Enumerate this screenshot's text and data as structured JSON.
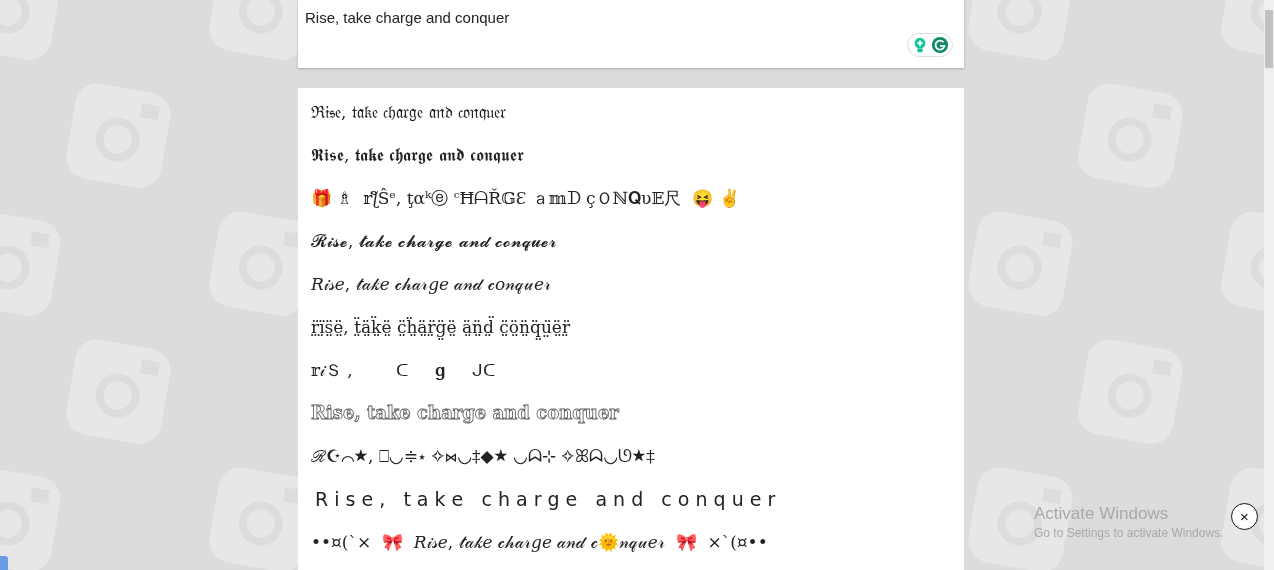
{
  "input": {
    "value": "Rise, take charge and conquer"
  },
  "results": [
    {
      "kind": "plain",
      "text": "ℜ𝔦𝔰𝔢, 𝔱𝔞𝔨𝔢 𝔠𝔥𝔞𝔯𝔤𝔢 𝔞𝔫𝔡 𝔠𝔬𝔫𝔮𝔲𝔢𝔯"
    },
    {
      "kind": "plain",
      "text": "𝕽𝖎𝖘𝖊, 𝖙𝖆𝖐𝖊 𝖈𝖍𝖆𝖗𝖌𝖊 𝖆𝖓𝖉 𝖈𝖔𝖓𝖖𝖚𝖊𝖗"
    },
    {
      "kind": "plain",
      "text": "🎁 ♗  𝕣ƪŜᵉ, ţαᵏⓔ ᶜĦᗩŘ𝔾Ɛ ａ𝕞ᗪ çＯℕ𝐐υ𝔼尺  😝 ✌"
    },
    {
      "kind": "plain",
      "text": "𝓡𝓲𝓼𝓮, 𝓽𝓪𝓴𝓮 𝓬𝓱𝓪𝓻𝓰𝓮 𝓪𝓷𝓭 𝓬𝓸𝓷𝓺𝓾𝓮𝓻"
    },
    {
      "kind": "plain",
      "text": "𝑅𝒾𝓈𝑒, 𝓉𝒶𝓀𝑒 𝒸𝒽𝒶𝓇𝑔𝑒 𝒶𝓃𝒹 𝒸𝑜𝓃𝓆𝓊𝑒𝓇"
    },
    {
      "kind": "plain",
      "text": "r̤̈ï̤s̤̈ë̤, ẗ̤ä̤k̤̈ë̤ c̤̈ḧ̤ä̤r̤̈g̤̈ë̤ ä̤n̤̈d̤̈ c̤̈ö̤n̤̈q̤̈ṳ̈ë̤r̤̈"
    },
    {
      "kind": "plain",
      "text": "𝕣𝒾Ｓ ,        ᑕ     𝐠     ᒍᑕ"
    },
    {
      "kind": "outline",
      "text": "Rise, take charge and conquer"
    },
    {
      "kind": "plain",
      "text": "ℛ☪⌒★, ⎕◡≑⋆ ✧⋈◡‡◆★ ◡ᗣ⊹ ✧ꕤᗣ◡ᘎ★‡"
    },
    {
      "kind": "spaced",
      "text": "R i s e ,   t a k e   c h a r g e   a n d   c o n q u e r"
    },
    {
      "kind": "plain",
      "text": "••¤(`×  🎀  𝑅𝒾𝓈𝑒, 𝓉𝒶𝓀𝑒 𝒸𝒽𝒶𝓇𝑔𝑒 𝒶𝓃𝒹 𝒸🌞𝓃𝓆𝓊𝑒𝓇  🎀  ×`(¤••"
    }
  ],
  "activation_notice": {
    "title": "Activate Windows",
    "subtitle": "Go to Settings to activate Windows."
  },
  "close_button": {
    "label": "×"
  }
}
